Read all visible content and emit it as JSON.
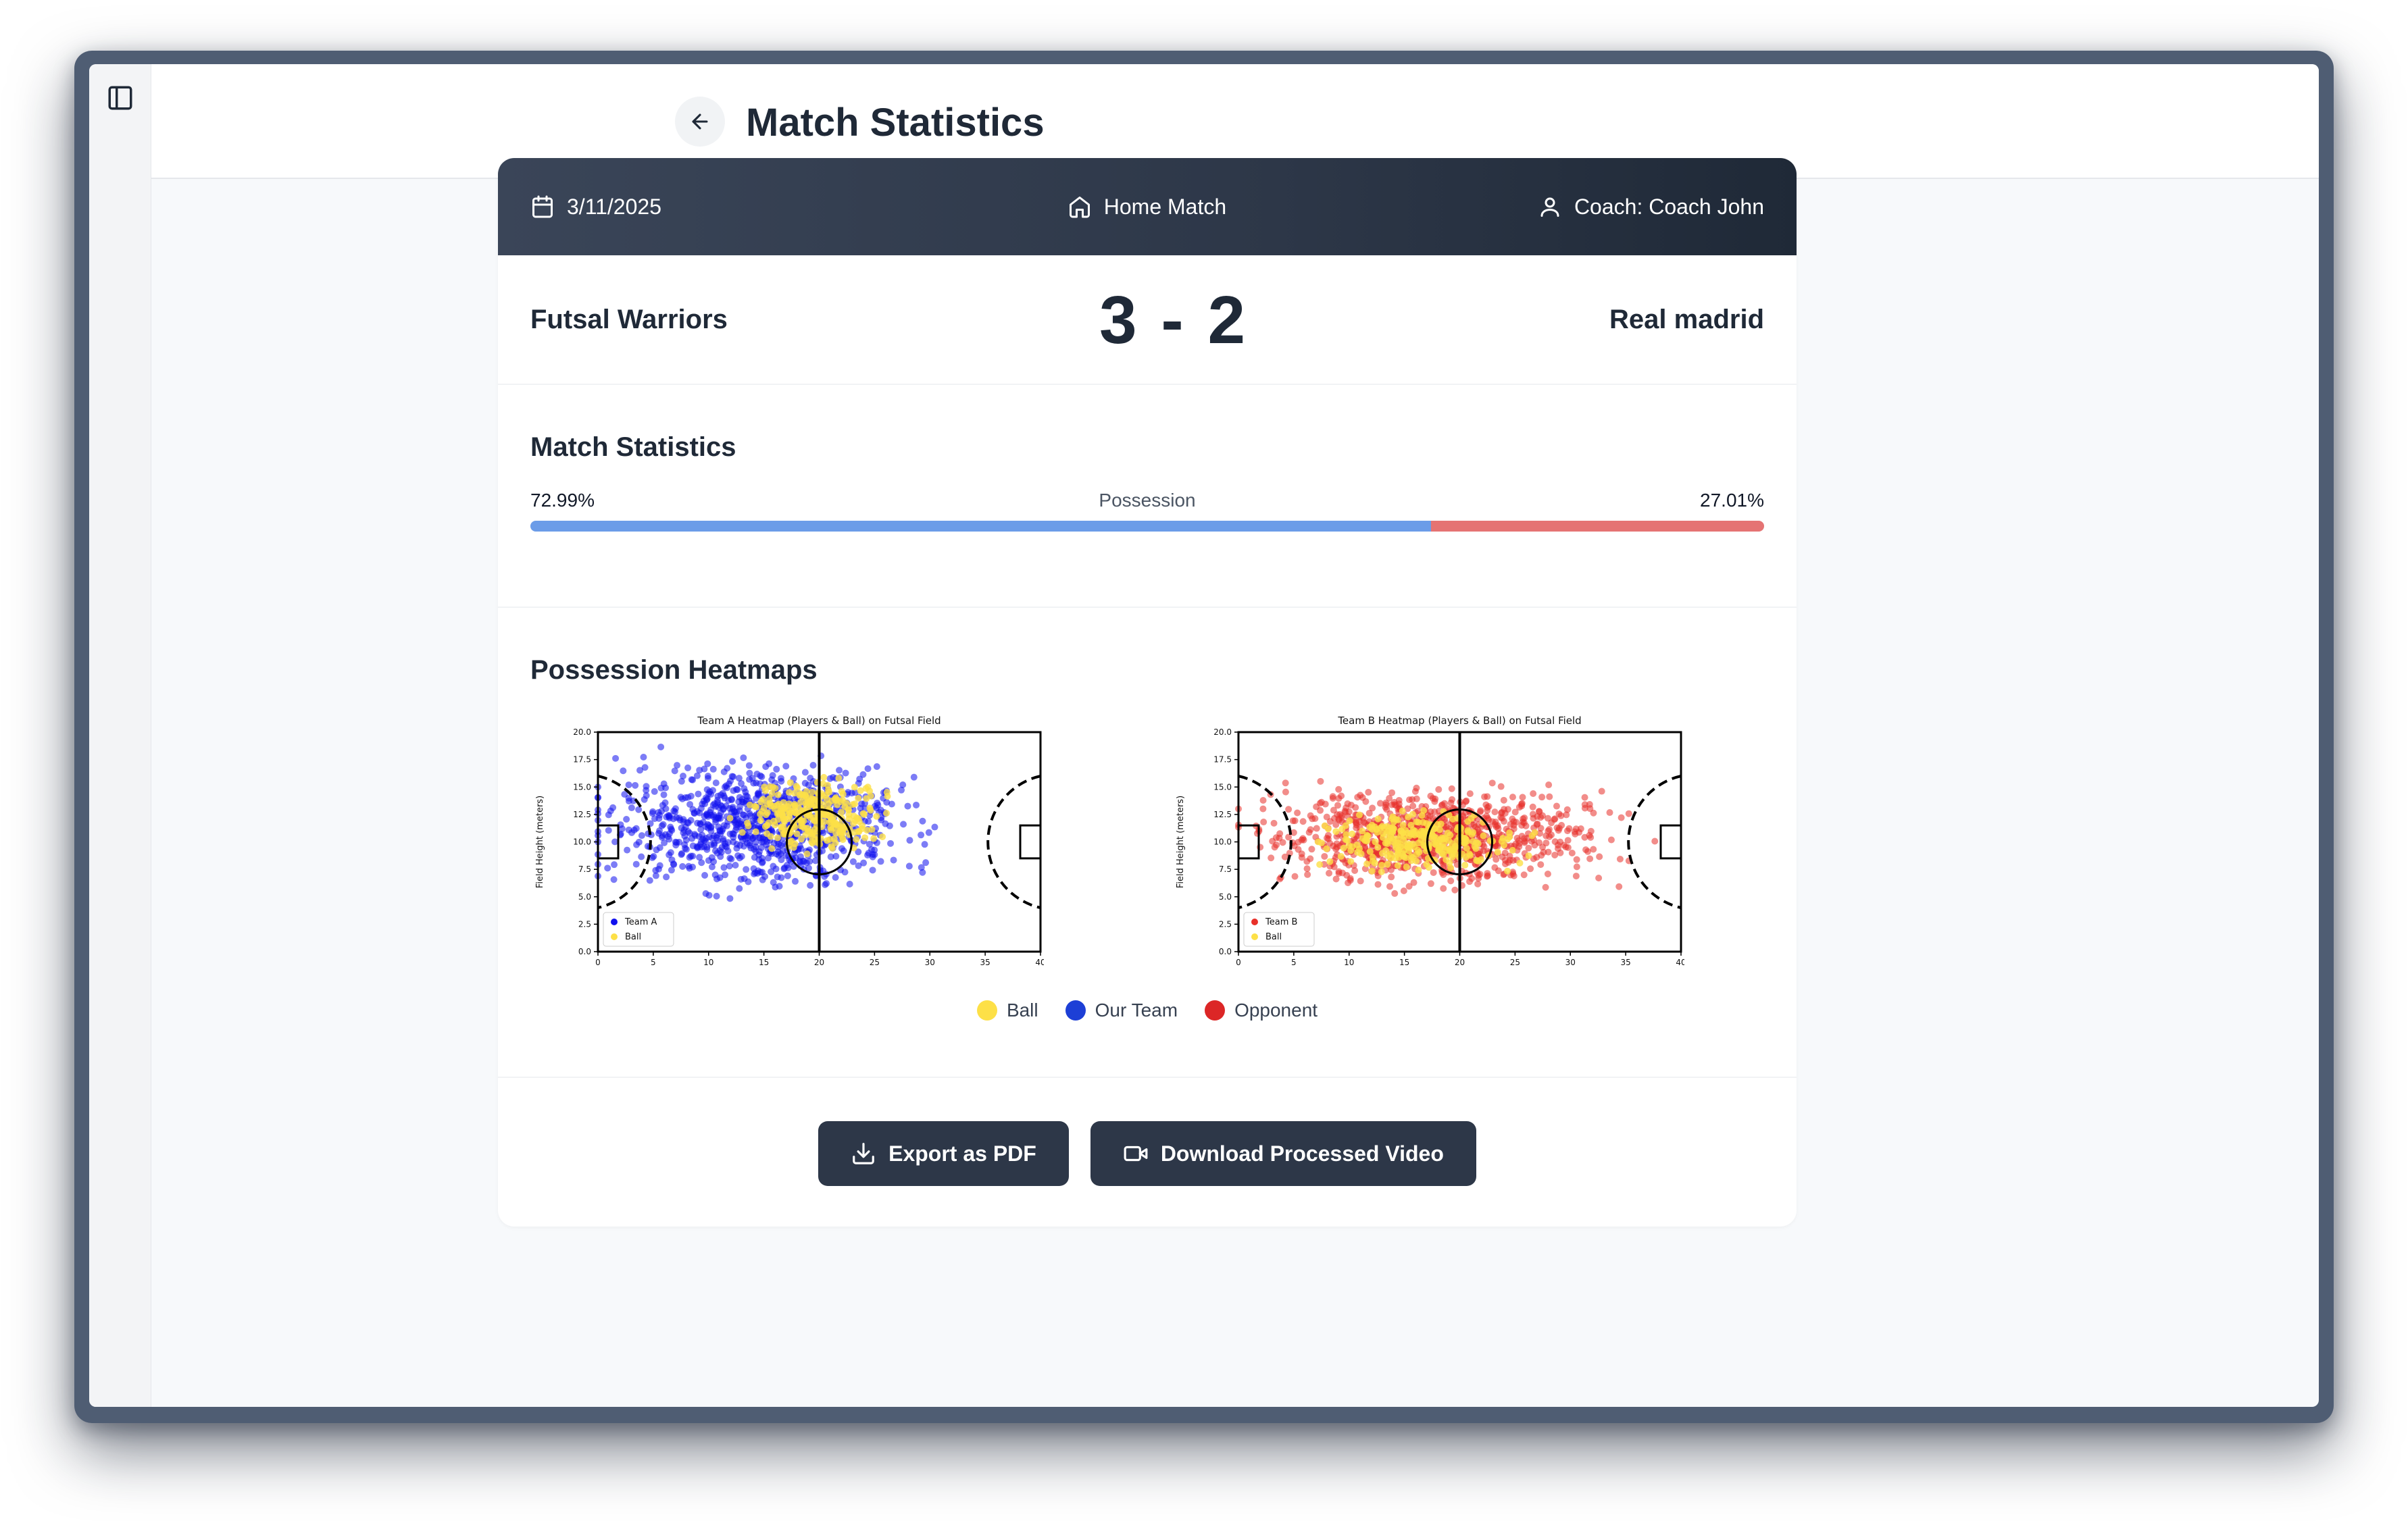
{
  "page": {
    "title": "Match Statistics"
  },
  "match": {
    "date": "3/11/2025",
    "venue": "Home Match",
    "coach": "Coach: Coach John",
    "home_team": "Futsal Warriors",
    "away_team": "Real madrid",
    "score": "3 - 2"
  },
  "stats": {
    "title": "Match Statistics",
    "possession_label": "Possession",
    "home_possession": "72.99%",
    "away_possession": "27.01%",
    "home_possession_value": 72.99,
    "away_possession_value": 27.01,
    "home_color": "#6b9ce8",
    "away_color": "#e57373"
  },
  "heatmaps": {
    "title": "Possession Heatmaps",
    "legend": [
      {
        "label": "Ball",
        "color": "#fde047"
      },
      {
        "label": "Our Team",
        "color": "#1d3fd6"
      },
      {
        "label": "Opponent",
        "color": "#dc2626"
      }
    ]
  },
  "chart_data": [
    {
      "type": "scatter",
      "title": "Team A Heatmap (Players & Ball) on Futsal Field",
      "ylabel": "Field Height (meters)",
      "xlabel": "",
      "xlim": [
        0,
        40
      ],
      "ylim": [
        0,
        20
      ],
      "x_ticks": [
        "0",
        "5",
        "10",
        "15",
        "20",
        "25",
        "30",
        "35",
        "40"
      ],
      "y_ticks": [
        "0.0",
        "2.5",
        "5.0",
        "7.5",
        "10.0",
        "12.5",
        "15.0",
        "17.5",
        "20.0"
      ],
      "legend_position": "lower-left",
      "series": [
        {
          "name": "Team A",
          "color": "#1010ee",
          "center_x": 14,
          "spread_x": 11,
          "center_y": 11.5,
          "spread_y": 4.5
        },
        {
          "name": "Ball",
          "color": "#fde047",
          "center_x": 19,
          "spread_x": 5,
          "center_y": 12.5,
          "spread_y": 2.5
        }
      ]
    },
    {
      "type": "scatter",
      "title": "Team B Heatmap (Players & Ball) on Futsal Field",
      "ylabel": "Field Height (meters)",
      "xlabel": "",
      "xlim": [
        0,
        40
      ],
      "ylim": [
        0,
        20
      ],
      "x_ticks": [
        "0",
        "5",
        "10",
        "15",
        "20",
        "25",
        "30",
        "35",
        "40"
      ],
      "y_ticks": [
        "0.0",
        "2.5",
        "5.0",
        "7.5",
        "10.0",
        "12.5",
        "15.0",
        "17.5",
        "20.0"
      ],
      "legend_position": "lower-left",
      "series": [
        {
          "name": "Team B",
          "color": "#e8302a",
          "center_x": 18,
          "spread_x": 12,
          "center_y": 10.5,
          "spread_y": 3.5
        },
        {
          "name": "Ball",
          "color": "#fde047",
          "center_x": 16,
          "spread_x": 7,
          "center_y": 10,
          "spread_y": 2
        }
      ]
    }
  ],
  "actions": {
    "export_pdf": "Export as PDF",
    "download_video": "Download Processed Video"
  }
}
